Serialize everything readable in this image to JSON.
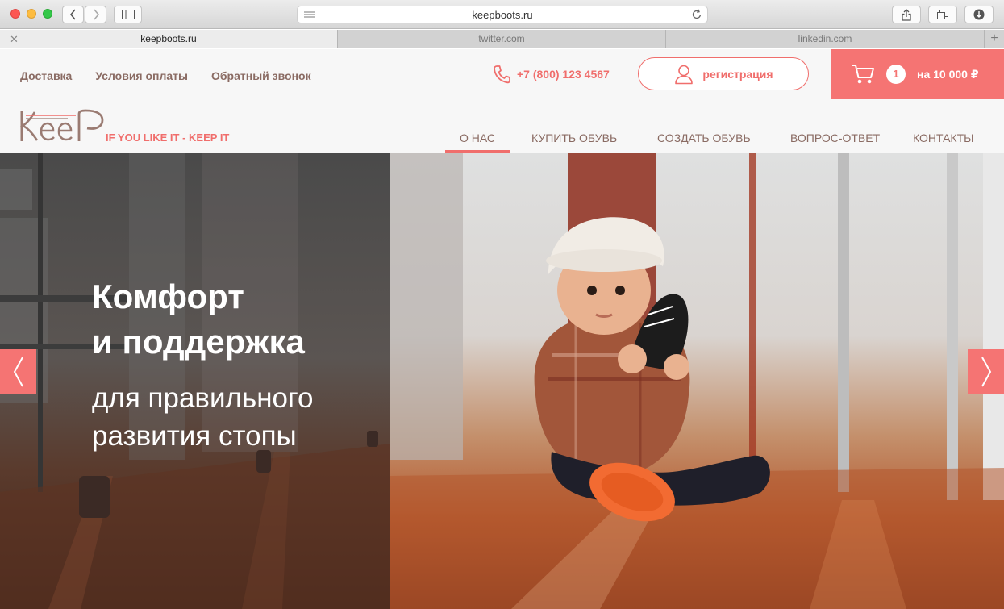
{
  "browser": {
    "url": "keepboots.ru",
    "tabs": [
      {
        "label": "keepboots.ru",
        "active": true
      },
      {
        "label": "twitter.com",
        "active": false
      },
      {
        "label": "linkedin.com",
        "active": false
      }
    ],
    "tab_close": "✕",
    "tab_add": "+"
  },
  "header": {
    "top_links": [
      "Доставка",
      "Условия оплаты",
      "Обратный звонок"
    ],
    "phone": "+7 (800) 123 4567",
    "register_label": "регистрация",
    "cart_count": "1",
    "cart_total": "на 10 000 ₽",
    "tagline": "IF YOU LIKE IT - KEEP IT",
    "logo_text": "KeeP"
  },
  "mainnav": {
    "items": [
      "О НАС",
      "КУПИТЬ ОБУВЬ",
      "СОЗДАТЬ ОБУВЬ",
      "ВОПРОС-ОТВЕТ",
      "КОНТАКТЫ"
    ],
    "active_index": 0
  },
  "hero": {
    "headline_line1": "Комфорт",
    "headline_line2": "и поддержка",
    "sub_line1": "для правильного",
    "sub_line2": "развития стопы"
  },
  "colors": {
    "accent": "#f06e6c",
    "cart_bg": "#f57473",
    "nav_text": "#8a6b63"
  },
  "icons": {
    "phone": "phone-icon",
    "user": "user-icon",
    "cart": "cart-icon",
    "prev": "chevron-left-icon",
    "next": "chevron-right-icon"
  }
}
